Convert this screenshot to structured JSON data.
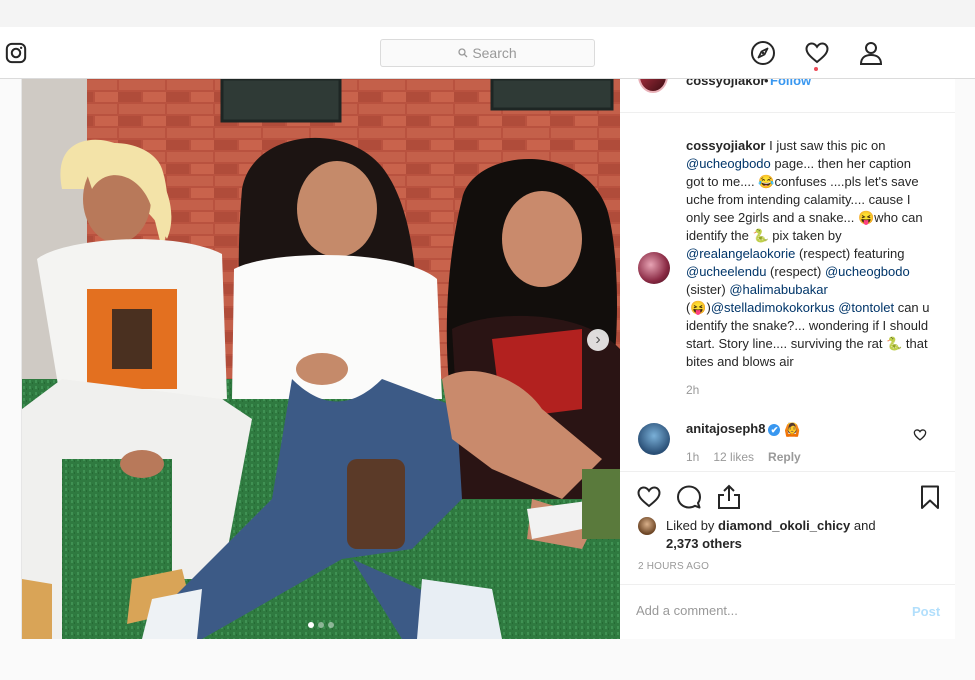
{
  "nav": {
    "search_placeholder": "Search",
    "logo_icon": "instagram-icon",
    "icons": [
      "explore-icon",
      "heart-icon",
      "profile-icon"
    ]
  },
  "post": {
    "header": {
      "username": "cossyojiakor",
      "separator": "•",
      "follow_label": "Follow"
    },
    "caption": {
      "username": "cossyojiakor",
      "t1": " I just saw this pic on ",
      "m1": "@ucheogbodo",
      "t2": " page... then her caption got to me.... 😂confuses ....pls let's save uche from intending calamity.... cause I only see 2girls and a snake... 😝who can identify the 🐍 pix taken by ",
      "m2": "@realangelaokorie",
      "t3": " (respect) featuring ",
      "m3": "@ucheelendu",
      "t4": " (respect) ",
      "m4": "@ucheogbodo",
      "t5": " (sister) ",
      "m5": "@halimabubakar",
      "t6": " (😝)",
      "m6": "@stelladimokokorkus",
      "t7": " ",
      "m7": "@tontolet",
      "t8": " can u identify the snake?... wondering if I should start. Story line.... surviving the rat 🐍 that bites and blows air",
      "time": "2h"
    },
    "comment": {
      "username": "anitajoseph8",
      "verified": "✔",
      "emoji": "🙆",
      "time": "1h",
      "likes": "12 likes",
      "reply_label": "Reply"
    },
    "likes": {
      "prefix": "Liked by ",
      "user": "diamond_okoli_chicy",
      "mid": " and",
      "count": "2,373 others"
    },
    "timestamp": "2 HOURS AGO",
    "add_comment_placeholder": "Add a comment...",
    "post_label": "Post",
    "next_arrow": "›"
  },
  "colors": {
    "link": "#003569",
    "follow": "#3897f0",
    "muted": "#999999",
    "post_disabled": "#b2dffc"
  }
}
